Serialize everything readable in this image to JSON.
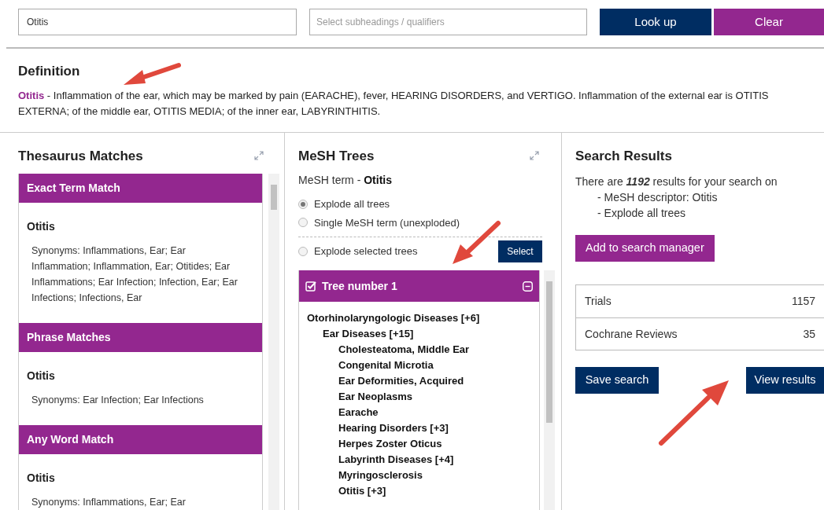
{
  "search": {
    "value": "Otitis",
    "qualifier_placeholder": "Select subheadings / qualifiers",
    "lookup_button": "Look up",
    "clear_button": "Clear"
  },
  "definition": {
    "title": "Definition",
    "term": "Otitis",
    "text": " - Inflammation of the ear, which may be marked by pain (EARACHE), fever, HEARING DISORDERS, and VERTIGO. Inflammation of the external ear is OTITIS EXTERNA; of the middle ear, OTITIS MEDIA; of the inner ear, LABYRINTHITIS."
  },
  "thesaurus": {
    "title": "Thesaurus Matches",
    "sections": [
      {
        "heading": "Exact Term Match",
        "term": "Otitis",
        "synonyms": "Synonyms: Inflammations, Ear; Ear Inflammation; Inflammation, Ear; Otitides; Ear Inflammations; Ear Infection; Infection, Ear; Ear Infections; Infections, Ear"
      },
      {
        "heading": "Phrase Matches",
        "term": "Otitis",
        "synonyms": "Synonyms: Ear Infection; Ear Infections"
      },
      {
        "heading": "Any Word Match",
        "term": "Otitis",
        "synonyms": "Synonyms: Inflammations, Ear; Ear"
      }
    ]
  },
  "mesh": {
    "title": "MeSH Trees",
    "term_label": "MeSH term - ",
    "term": "Otitis",
    "options": [
      {
        "label": "Explode all trees",
        "selected": true
      },
      {
        "label": "Single MeSH term (unexploded)",
        "selected": false
      }
    ],
    "selected_trees_option": {
      "label": "Explode selected trees",
      "selected": false
    },
    "select_button": "Select",
    "tree_panel": {
      "title": "Tree number 1",
      "checked": true,
      "expanded": true,
      "tree": [
        {
          "label": "Otorhinolaryngologic Diseases [+6]",
          "children": [
            {
              "label": "Ear Diseases [+15]",
              "children": [
                {
                  "label": "Cholesteatoma, Middle Ear"
                },
                {
                  "label": "Congenital Microtia"
                },
                {
                  "label": "Ear Deformities, Acquired"
                },
                {
                  "label": "Ear Neoplasms"
                },
                {
                  "label": "Earache"
                },
                {
                  "label": "Hearing Disorders [+3]"
                },
                {
                  "label": "Herpes Zoster Oticus"
                },
                {
                  "label": "Labyrinth Diseases [+4]"
                },
                {
                  "label": "Myringosclerosis"
                },
                {
                  "label": "Otitis [+3]"
                }
              ]
            }
          ]
        }
      ]
    }
  },
  "results": {
    "title": "Search Results",
    "summary": "There are **1192** results for your search on",
    "criteria": [
      "- MeSH descriptor: Otitis",
      "- Explode all trees"
    ],
    "add_button": "Add to search manager",
    "counts": [
      {
        "label": "Trials",
        "count": "1157"
      },
      {
        "label": "Cochrane Reviews",
        "count": "35"
      }
    ],
    "save_button": "Save search",
    "view_button": "View results"
  }
}
